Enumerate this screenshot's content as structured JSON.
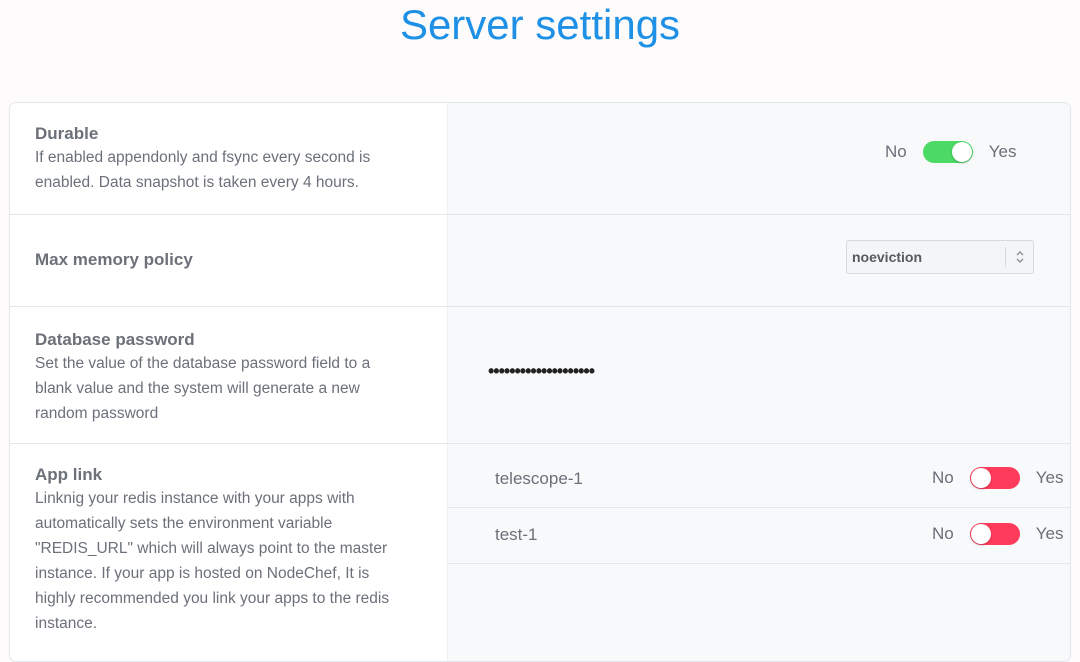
{
  "page": {
    "title": "Server settings"
  },
  "settings": {
    "durable": {
      "title": "Durable",
      "description_line1": "If enabled appendonly and fsync every second is",
      "description_line2": "enabled. Data snapshot is taken every 4 hours.",
      "toggle": {
        "no_label": "No",
        "yes_label": "Yes",
        "state": "on"
      }
    },
    "max_memory_policy": {
      "title": "Max memory policy",
      "selected": "noeviction"
    },
    "database_password": {
      "title": "Database password",
      "description_line1": "Set the value of the database password field to a",
      "description_line2": "blank value and the system will generate a new",
      "description_line3": "random password",
      "masked_value": "••••••••••••••••••••"
    },
    "app_link": {
      "title": "App link",
      "description_line1": "Linknig your redis instance with your apps with",
      "description_line2": "automatically sets the environment variable",
      "description_line3": "\"REDIS_URL\" which will always point to the master",
      "description_line4": "instance. If your app is hosted on NodeChef, It is",
      "description_line5": "highly recommended you link your apps to the redis",
      "description_line6": "instance.",
      "apps": [
        {
          "name": "telescope-1",
          "no_label": "No",
          "yes_label": "Yes",
          "state": "off"
        },
        {
          "name": "test-1",
          "no_label": "No",
          "yes_label": "Yes",
          "state": "off"
        }
      ]
    }
  },
  "colors": {
    "title": "#1e90e6",
    "toggle_on": "#4cd964",
    "toggle_off": "#ff3b5c"
  }
}
